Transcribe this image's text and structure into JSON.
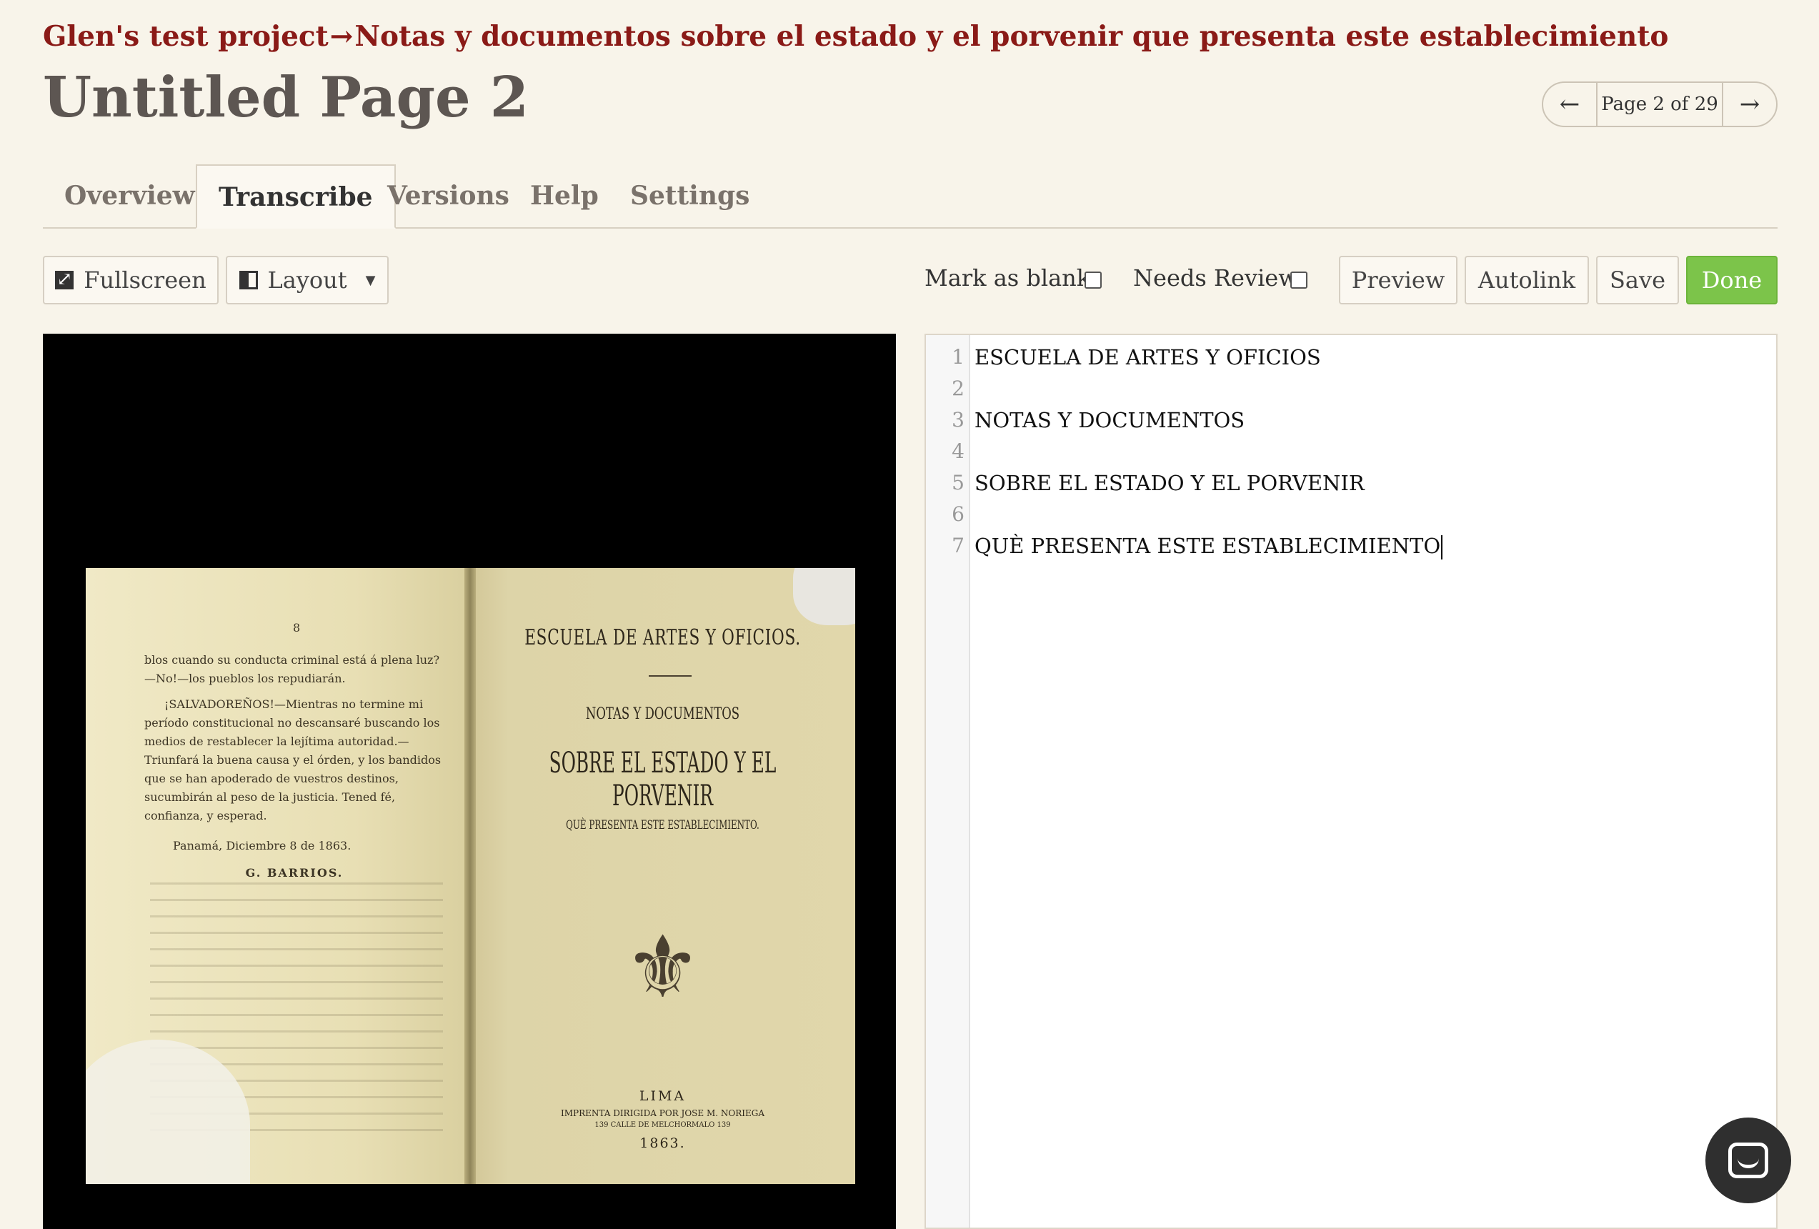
{
  "breadcrumb": {
    "project": "Glen's test project",
    "separator": "→",
    "document": "Notas y documentos sobre el estado y el porvenir que presenta este establecimiento"
  },
  "page": {
    "title": "Untitled Page 2"
  },
  "pager": {
    "label": "Page 2 of 29",
    "prev_icon": "arrow-left-icon",
    "next_icon": "arrow-right-icon"
  },
  "tabs": [
    {
      "label": "Overview",
      "active": false
    },
    {
      "label": "Transcribe",
      "active": true
    },
    {
      "label": "Versions",
      "active": false
    },
    {
      "label": "Help",
      "active": false
    },
    {
      "label": "Settings",
      "active": false
    }
  ],
  "toolbar": {
    "fullscreen_label": "Fullscreen",
    "layout_label": "Layout",
    "mark_blank_label": "Mark as blank",
    "mark_blank_checked": false,
    "needs_review_label": "Needs Review",
    "needs_review_checked": false,
    "preview_label": "Preview",
    "autolink_label": "Autolink",
    "save_label": "Save",
    "done_label": "Done"
  },
  "scan": {
    "left_page": {
      "page_number": "8",
      "paragraphs": [
        "blos cuando su conducta criminal está á plena luz? —No!—los pueblos los repudiarán.",
        "¡SALVADOREÑOS!—Mientras no termine mi período constitucional no descansaré buscando los medios de restablecer la lejítima autoridad.—Triunfará la buena causa y el órden, y los bandidos que se han apoderado de vuestros destinos, sucumbirán al peso de la justicia. Tened fé, confianza, y esperad.",
        "Panamá, Diciembre 8 de 1863.",
        "G. BARRIOS."
      ]
    },
    "right_page": {
      "heading1": "ESCUELA DE ARTES Y OFICIOS.",
      "heading2": "NOTAS Y DOCUMENTOS",
      "heading3": "SOBRE EL ESTADO Y EL PORVENIR",
      "heading4": "QUÈ PRESENTA ESTE ESTABLECIMIENTO.",
      "city": "LIMA",
      "printer": "IMPRENTA DIRIGIDA POR JOSE M. NORIEGA",
      "street": "139 CALLE DE MELCHORMALO 139",
      "year": "1863."
    }
  },
  "editor": {
    "lines": [
      {
        "n": "1",
        "text": "ESCUELA DE ARTES Y OFICIOS"
      },
      {
        "n": "2",
        "text": ""
      },
      {
        "n": "3",
        "text": "NOTAS Y DOCUMENTOS"
      },
      {
        "n": "4",
        "text": ""
      },
      {
        "n": "5",
        "text": "SOBRE EL ESTADO Y EL PORVENIR"
      },
      {
        "n": "6",
        "text": ""
      },
      {
        "n": "7",
        "text": "QUÈ PRESENTA ESTE ESTABLECIMIENTO"
      }
    ]
  },
  "colors": {
    "breadcrumb": "#8a1a17",
    "title": "#5d5652",
    "background": "#f8f4ea",
    "done_button": "#7cc44a",
    "chat_button": "#2f2f2f"
  }
}
